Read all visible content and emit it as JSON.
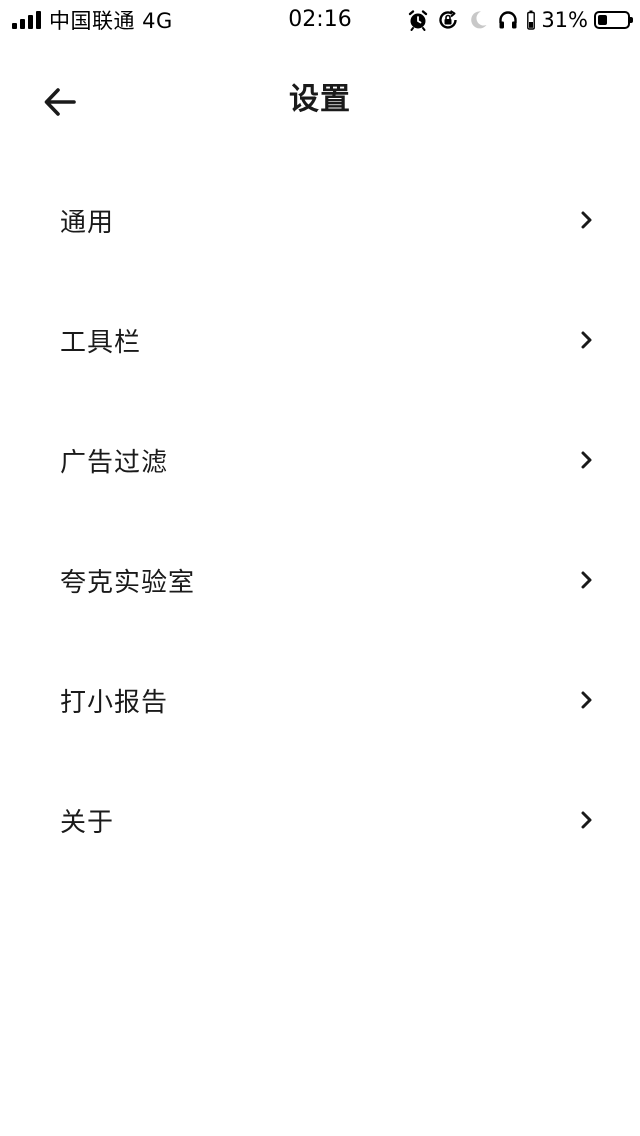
{
  "status_bar": {
    "carrier": "中国联通 4G",
    "time": "02:16",
    "battery_percent_text": "31%",
    "battery_level": 0.31,
    "icons": [
      "alarm-icon",
      "orientation-lock-icon",
      "moon-icon",
      "headphones-icon",
      "battery-icon"
    ]
  },
  "header": {
    "title": "设置",
    "back_icon": "arrow-left-icon"
  },
  "settings": {
    "items": [
      {
        "label": "通用"
      },
      {
        "label": "工具栏"
      },
      {
        "label": "广告过滤"
      },
      {
        "label": "夸克实验室"
      },
      {
        "label": "打小报告"
      },
      {
        "label": "关于"
      }
    ],
    "chevron_icon": "chevron-right-icon"
  },
  "colors": {
    "background": "#ffffff",
    "text": "#1a1a1a"
  }
}
